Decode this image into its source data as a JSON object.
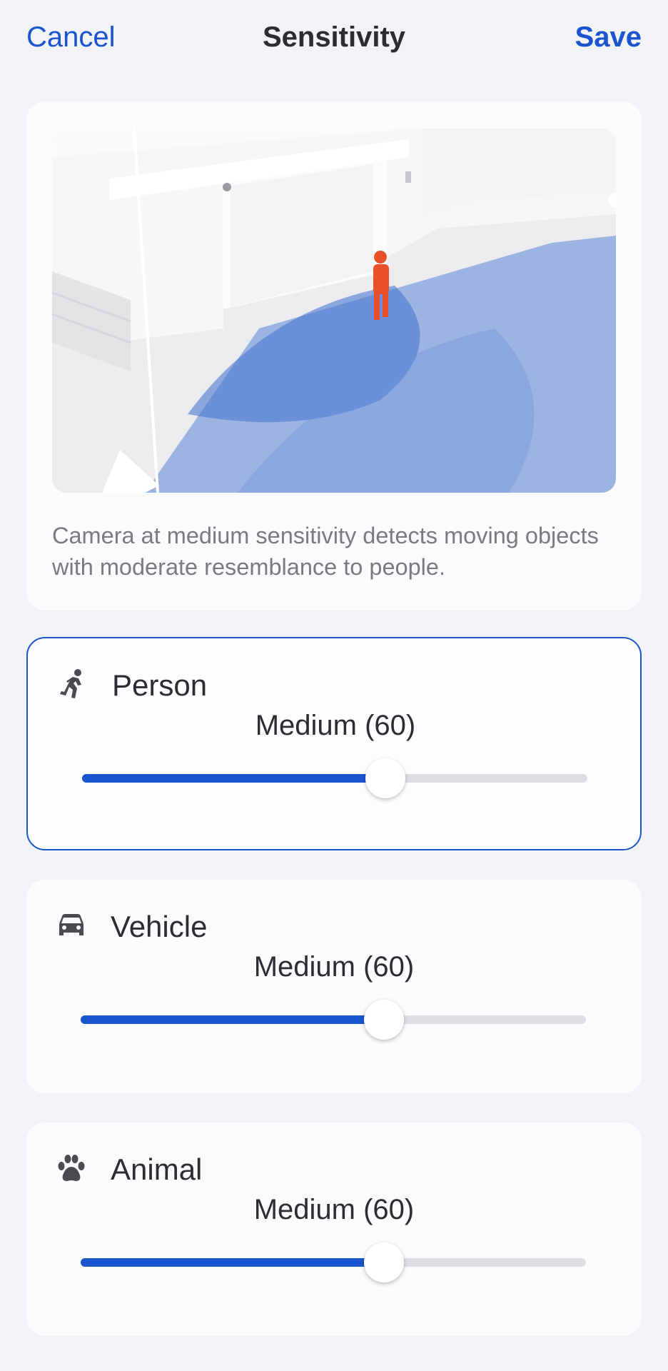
{
  "header": {
    "cancel_label": "Cancel",
    "title": "Sensitivity",
    "save_label": "Save"
  },
  "preview": {
    "caption": "Camera at medium sensitivity detects moving objects with moderate resemblance to people."
  },
  "categories": [
    {
      "key": "person",
      "label": "Person",
      "icon": "running-person-icon",
      "value_text": "Medium (60)",
      "level": 60,
      "selected": true
    },
    {
      "key": "vehicle",
      "label": "Vehicle",
      "icon": "car-icon",
      "value_text": "Medium (60)",
      "level": 60,
      "selected": false
    },
    {
      "key": "animal",
      "label": "Animal",
      "icon": "paw-icon",
      "value_text": "Medium (60)",
      "level": 60,
      "selected": false
    }
  ],
  "colors": {
    "accent": "#1a55cf",
    "background": "#f2f3f7",
    "card": "#fbfbfd",
    "text": "#2c2d31",
    "secondary_text": "#7a7b80",
    "track": "#dedfe3",
    "detection_zone": "#5b86d6",
    "person_figure": "#e8502b"
  }
}
